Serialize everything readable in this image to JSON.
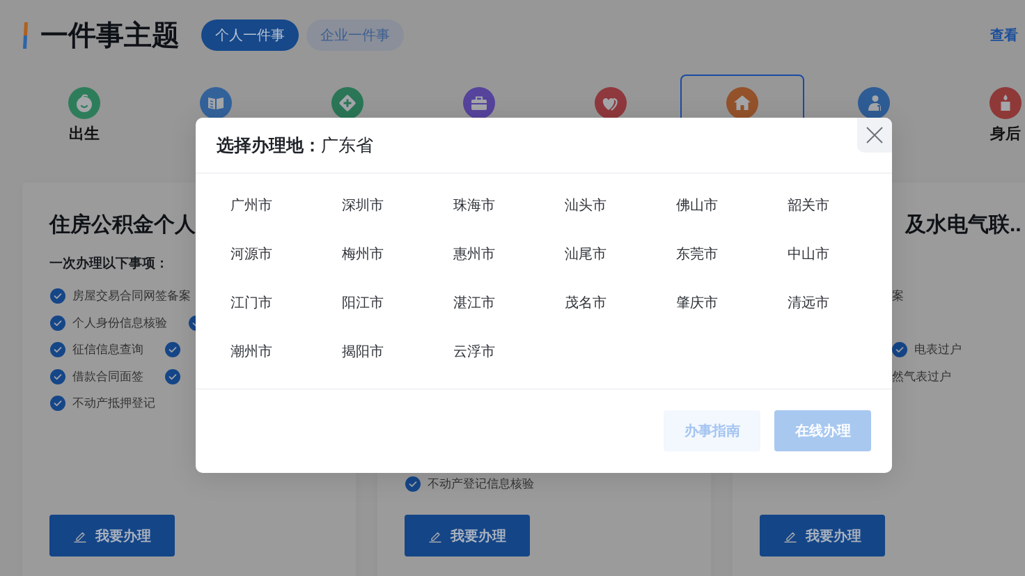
{
  "header": {
    "title": "一件事主题",
    "more_link": "查看"
  },
  "tabs": [
    {
      "label": "个人一件事",
      "selected": true
    },
    {
      "label": "企业一件事",
      "selected": false
    }
  ],
  "categories": [
    {
      "label": "出生",
      "color": "#2e7d5a",
      "selected": false
    },
    {
      "color": "#33629b",
      "selected": false
    },
    {
      "color": "#2a7656",
      "selected": false
    },
    {
      "color": "#56439c",
      "selected": false
    },
    {
      "color": "#8f383d",
      "selected": false
    },
    {
      "color": "#94522a",
      "selected": true
    },
    {
      "color": "#2e5c95",
      "selected": false
    },
    {
      "label": "身后",
      "color": "#8f3838",
      "selected": false
    }
  ],
  "cards": [
    {
      "title": "住房公积金个人",
      "subtitle": "一次办理以下事项：",
      "rows": [
        [
          {
            "label": "房屋交易合同网签备案",
            "tick": true
          }
        ],
        [
          {
            "label": "个人身份信息核验",
            "tick": true
          },
          {
            "tick": true
          }
        ],
        [
          {
            "label": "征信信息查询",
            "tick": true
          },
          {
            "tick": true
          }
        ],
        [
          {
            "label": "借款合同面签",
            "tick": true
          },
          {
            "tick": true
          }
        ],
        [
          {
            "label": "不动产抵押登记",
            "tick": true
          }
        ]
      ],
      "button": "我要办理"
    },
    {
      "rows": [
        [
          {
            "label": "不动产登记信息核验",
            "tick": true
          }
        ]
      ],
      "button": "我要办理"
    },
    {
      "title": "及水电气联..",
      "rows": [
        [
          {
            "label": "案",
            "tick": false
          }
        ],
        [],
        [
          {
            "label": "电表过户",
            "tick": true
          }
        ],
        [
          {
            "label": "然气表过户",
            "tick": false
          }
        ]
      ],
      "button": "我要办理"
    }
  ],
  "dialog": {
    "title": "**选择办理地：**广东省",
    "cities": [
      {
        "name": "广州市",
        "selected": false
      },
      {
        "name": "深圳市",
        "selected": false
      },
      {
        "name": "珠海市",
        "selected": false
      },
      {
        "name": "汕头市",
        "selected": false
      },
      {
        "name": "佛山市",
        "selected": false
      },
      {
        "name": "韶关市",
        "selected": false
      },
      {
        "name": "河源市",
        "selected": false
      },
      {
        "name": "梅州市",
        "selected": false
      },
      {
        "name": "惠州市",
        "selected": false
      },
      {
        "name": "汕尾市",
        "selected": false
      },
      {
        "name": "东莞市",
        "selected": false
      },
      {
        "name": "中山市",
        "selected": false
      },
      {
        "name": "江门市",
        "selected": false
      },
      {
        "name": "阳江市",
        "selected": false
      },
      {
        "name": "湛江市",
        "selected": false
      },
      {
        "name": "茂名市",
        "selected": false
      },
      {
        "name": "肇庆市",
        "selected": false
      },
      {
        "name": "清远市",
        "selected": false
      },
      {
        "name": "潮州市",
        "selected": false
      },
      {
        "name": "揭阳市",
        "selected": false
      },
      {
        "name": "云浮市",
        "selected": false
      }
    ],
    "buttons": [
      {
        "label": "办事指南",
        "kind": "secondary",
        "disabled": true
      },
      {
        "label": "在线办理",
        "kind": "primary",
        "disabled": true
      }
    ]
  }
}
